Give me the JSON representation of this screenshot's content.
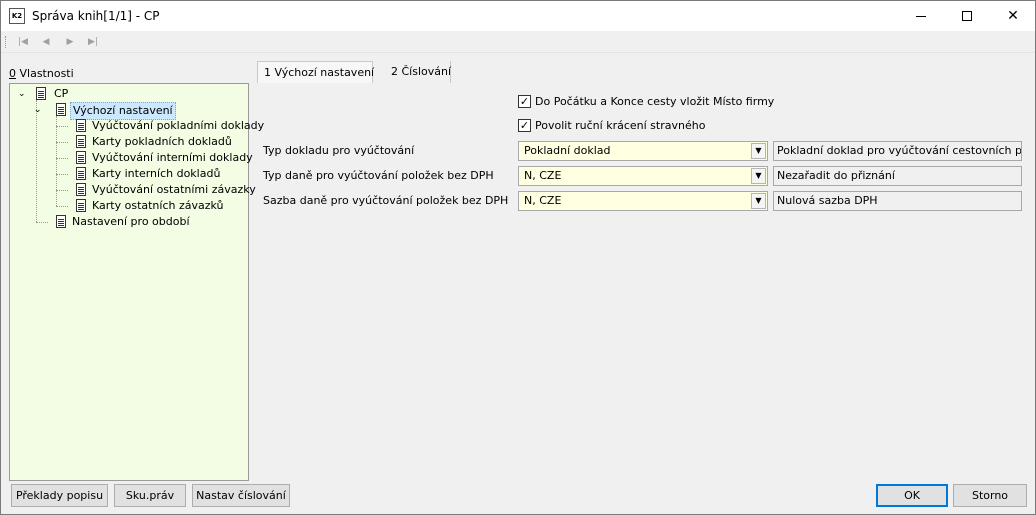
{
  "window": {
    "app_icon_text": "K2",
    "title": "Správa knih[1/1] - CP",
    "minimize_icon": "minimize-icon",
    "maximize_icon": "maximize-icon",
    "close_icon": "close-icon",
    "close_glyph": "✕"
  },
  "navigation": {
    "first_glyph": "|◀",
    "prev_glyph": "◀",
    "next_glyph": "▶",
    "last_glyph": "▶|"
  },
  "properties_panel": {
    "hotkey": "0",
    "label_rest": " Vlastnosti",
    "tree": {
      "root": {
        "label": "CP",
        "expander": "⌄"
      },
      "default_settings": {
        "label": "Výchozí nastavení",
        "expander": "⌄"
      },
      "children": [
        "Vyúčtování pokladními doklady",
        "Karty pokladních dokladů",
        "Vyúčtování interními doklady",
        "Karty interních dokladů",
        "Vyúčtování ostatními závazky",
        "Karty ostatních závazků"
      ],
      "period_settings": "Nastavení pro období"
    }
  },
  "tabs": [
    {
      "label": "1 Výchozí nastavení",
      "active": true
    },
    {
      "label": "2 Číslování",
      "active": false
    }
  ],
  "checkboxes": [
    {
      "label": "Do Počátku a Konce cesty vložit Místo firmy",
      "checked": true
    },
    {
      "label": "Povolit ruční krácení stravného",
      "checked": true
    }
  ],
  "check_glyph": "✓",
  "fields": [
    {
      "label": "Typ dokladu pro vyúčtování",
      "value": "Pokladní doklad",
      "description": "Pokladní doklad pro vyúčtování cestovních příkazů"
    },
    {
      "label": "Typ daně pro vyúčtování položek bez DPH",
      "value": "N, CZE",
      "description": "Nezařadit do přiznání"
    },
    {
      "label": "Sazba daně pro vyúčtování položek bez DPH",
      "value": "N, CZE",
      "description": "Nulová sazba DPH"
    }
  ],
  "dropdown_glyph": "▼",
  "buttons": {
    "translations": "Překlady popisu",
    "rights_groups": "Sku.práv",
    "set_numbering": "Nastav číslování",
    "ok": "OK",
    "cancel": "Storno"
  },
  "colors": {
    "tree_background": "#f3fde3",
    "combo_background": "#ffffe1",
    "selection": "#cce8ff",
    "primary_button_border": "#0078d7"
  }
}
